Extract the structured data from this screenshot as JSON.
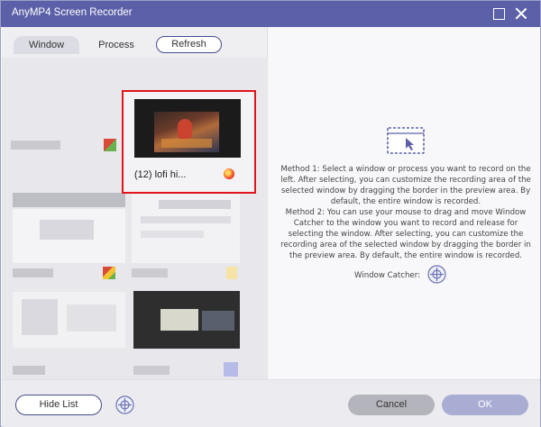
{
  "app": {
    "title": "AnyMP4 Screen Recorder",
    "icon": "app-logo-icon",
    "brand_color": "#5b60a8"
  },
  "titlebar": {
    "maximize_icon": "maximize-icon",
    "close_icon": "close-icon"
  },
  "tabs": {
    "window_label": "Window",
    "process_label": "Process",
    "refresh_label": "Refresh"
  },
  "windows_list": {
    "selected": {
      "label": "(12) lofi hi...",
      "app_icon": "firefox-icon",
      "highlight_color": "#e0141a"
    }
  },
  "instructions": {
    "icon": "window-select-icon",
    "method1": "Method 1: Select a window or process you want to record on the left. After selecting, you can customize the recording area of the selected window by dragging the border in the preview area. By default, the entire window is recorded.",
    "method2": "Method 2: You can use your mouse to drag and move Window Catcher to the window you want to record and release for selecting the window. After selecting, you can customize the recording area of the selected window by dragging the border in the preview area. By default, the entire window is recorded.",
    "catcher_label": "Window Catcher:",
    "catcher_icon": "crosshair-icon"
  },
  "footer": {
    "hide_list_label": "Hide List",
    "catcher_icon": "crosshair-icon",
    "cancel_label": "Cancel",
    "ok_label": "OK"
  }
}
